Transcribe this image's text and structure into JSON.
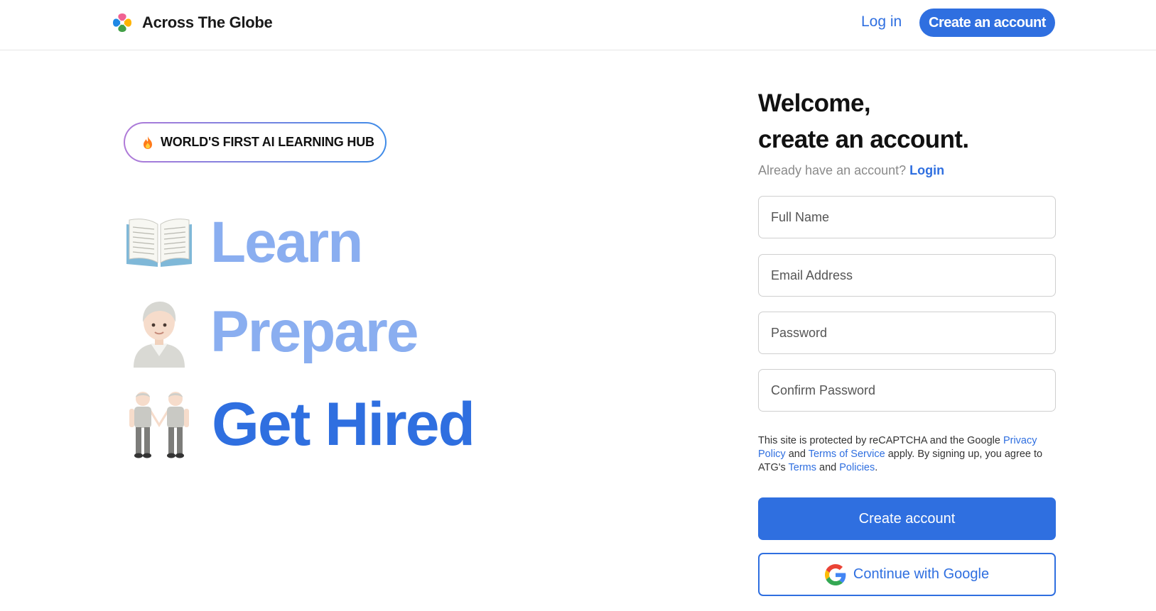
{
  "header": {
    "brand_name": "Across The Globe",
    "login_label": "Log in",
    "create_account_label": "Create an account"
  },
  "hero": {
    "badge_text": "WORLD'S FIRST AI LEARNING HUB",
    "badge_icon": "flame-icon",
    "rows": [
      {
        "icon": "open-book-icon",
        "word": "Learn"
      },
      {
        "icon": "person-icon",
        "word": "Prepare"
      },
      {
        "icon": "two-people-holding-hands-icon",
        "word": "Get Hired"
      }
    ]
  },
  "form": {
    "heading_line1": "Welcome,",
    "heading_line2": "create an account.",
    "already_text": "Already have an account?",
    "login_link": "Login",
    "fields": [
      {
        "placeholder": "Full Name",
        "value": ""
      },
      {
        "placeholder": "Email Address",
        "value": ""
      },
      {
        "placeholder": "Password",
        "value": ""
      },
      {
        "placeholder": "Confirm Password",
        "value": ""
      }
    ],
    "legal": {
      "part1": "This site is protected by reCAPTCHA and the Google ",
      "privacy_link": "Privacy Policy",
      "part2": " and ",
      "terms_service_link": "Terms of Service",
      "part3": " apply. By signing up, you agree to ATG's ",
      "terms_link": "Terms",
      "part4": " and ",
      "policies_link": "Policies",
      "part5": "."
    },
    "create_button": "Create account",
    "google_button": "Continue with Google"
  },
  "colors": {
    "accent": "#2f6fe0",
    "hero_light": "#8aaef0",
    "badge_border_start": "#b07ad8",
    "badge_border_end": "#3f8ce8"
  }
}
